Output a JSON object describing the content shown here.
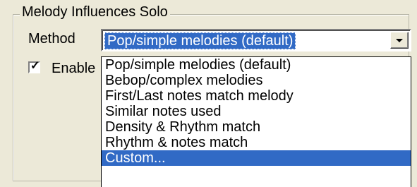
{
  "group": {
    "title": "Melody Influences Solo"
  },
  "method": {
    "label": "Method",
    "selected_value": "Pop/simple melodies (default)",
    "options": [
      "Pop/simple melodies (default)",
      "Bebop/complex melodies",
      "First/Last notes match melody",
      "Similar notes used",
      "Density & Rhythm match",
      "Rhythm & notes match",
      "Custom..."
    ],
    "highlighted_option": "Custom..."
  },
  "enable_checkbox": {
    "label_visible": "Enable",
    "checked": true
  },
  "colors": {
    "selection": "#316ac5",
    "dialog_bg": "#ece9d8"
  }
}
